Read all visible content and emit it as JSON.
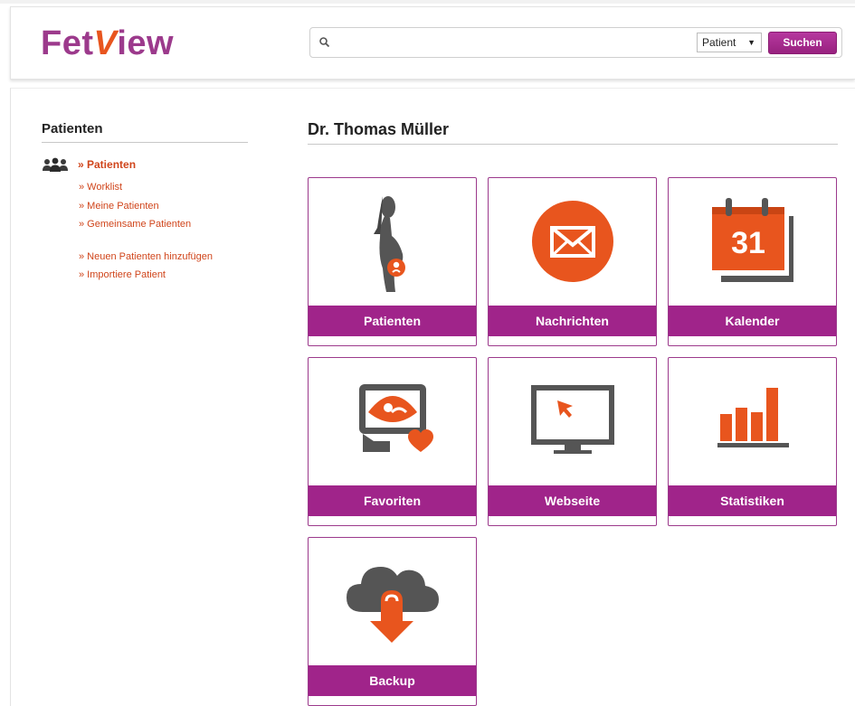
{
  "header": {
    "logo": {
      "part1": "Fet",
      "part2": "V",
      "part3": "iew"
    },
    "search": {
      "value": "",
      "placeholder": "",
      "scope": "Patient",
      "button": "Suchen"
    }
  },
  "sidebar": {
    "title": "Patienten",
    "main_link": "» Patienten",
    "links": [
      "» Worklist",
      "» Meine Patienten",
      "» Gemeinsame Patienten"
    ],
    "actions": [
      "» Neuen Patienten hinzufügen",
      "» Importiere Patient"
    ]
  },
  "main": {
    "title": "Dr. Thomas Müller",
    "tiles": [
      {
        "label": "Patienten",
        "icon": "pregnant-woman-icon"
      },
      {
        "label": "Nachrichten",
        "icon": "envelope-icon"
      },
      {
        "label": "Kalender",
        "icon": "calendar-icon",
        "badge": "31"
      },
      {
        "label": "Favoriten",
        "icon": "favorite-ultrasound-icon"
      },
      {
        "label": "Webseite",
        "icon": "monitor-cursor-icon"
      },
      {
        "label": "Statistiken",
        "icon": "bar-chart-icon"
      },
      {
        "label": "Backup",
        "icon": "cloud-download-icon"
      }
    ]
  },
  "colors": {
    "brand_purple": "#a0248a",
    "accent_orange": "#e8551e",
    "icon_gray": "#555555"
  }
}
